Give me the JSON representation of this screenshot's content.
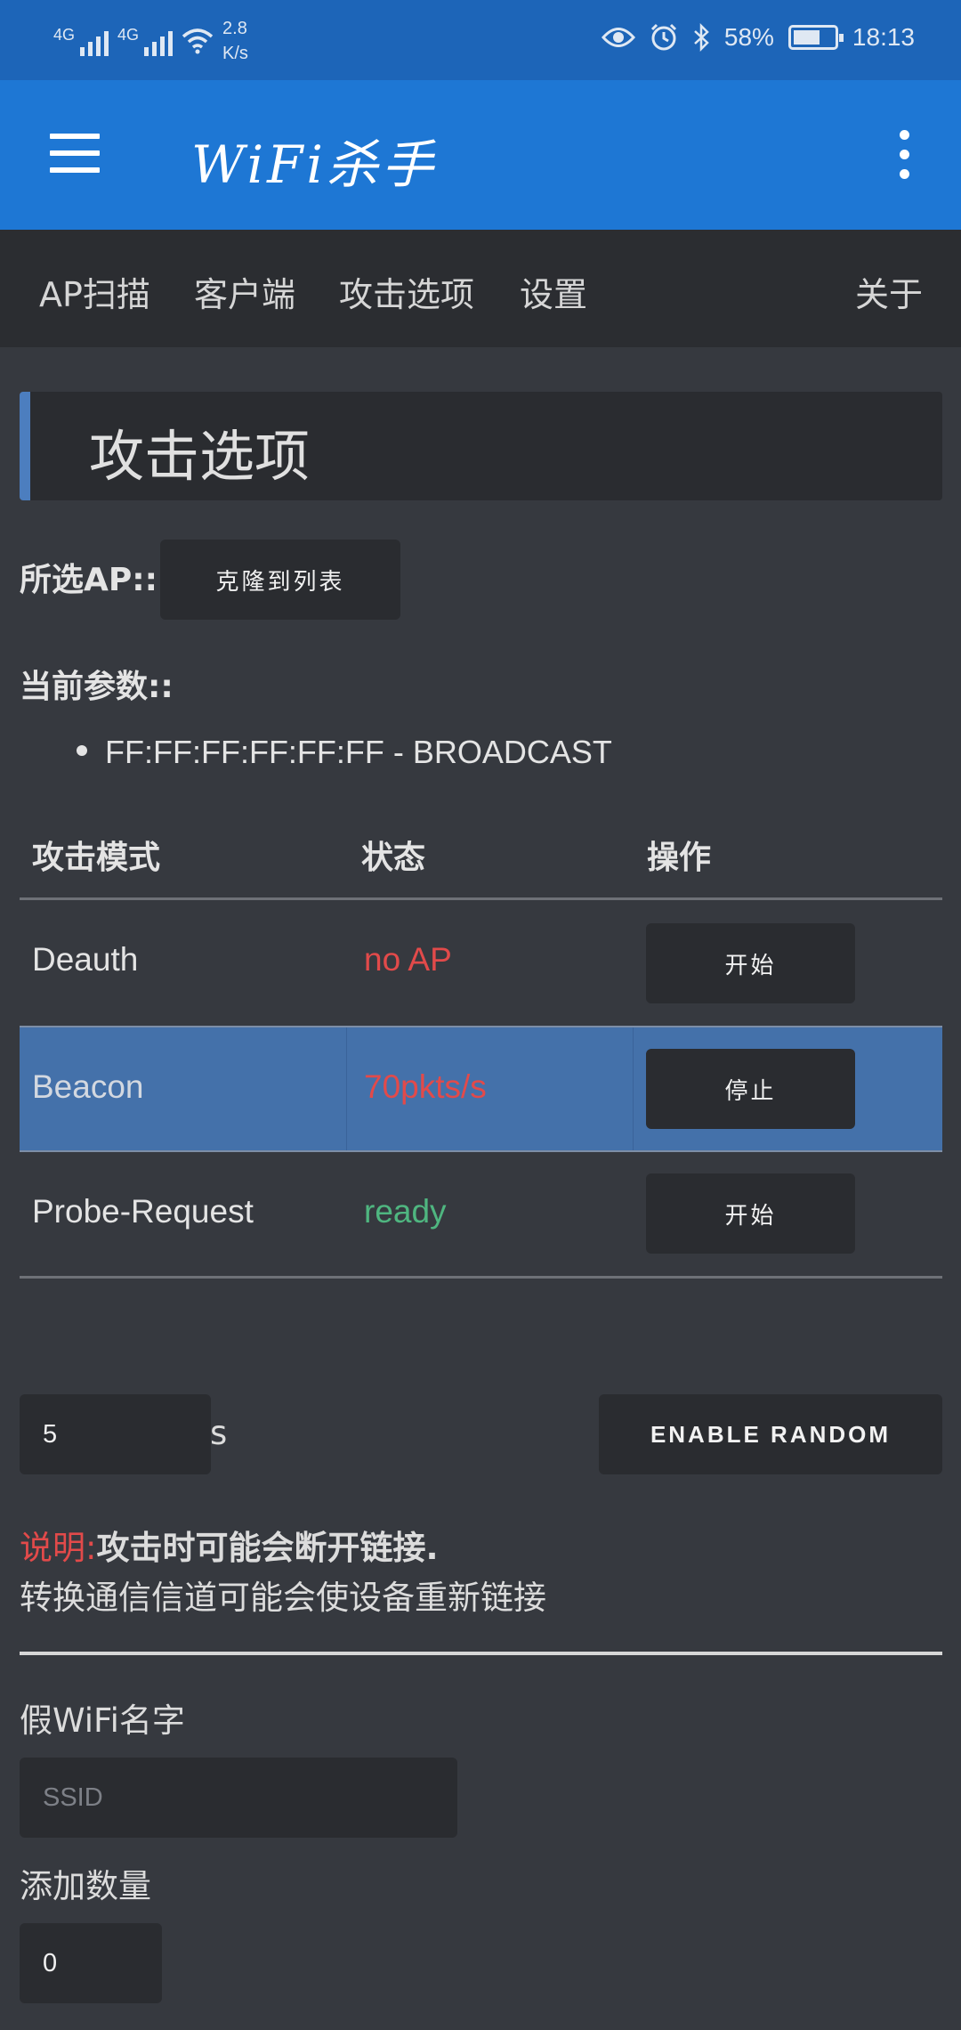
{
  "status_bar": {
    "signal1": "4G",
    "signal2": "4G",
    "net_speed_value": "2.8",
    "net_speed_unit": "K/s",
    "battery_percent": "58%",
    "battery_level": 0.58,
    "time": "18:13",
    "icons": [
      "eye-comfort-icon",
      "alarm-icon",
      "bluetooth-icon",
      "battery-icon"
    ]
  },
  "app_bar": {
    "title": "WiFi杀手",
    "menu_icon": "hamburger-icon",
    "overflow_icon": "kebab-menu-icon"
  },
  "tabs": [
    "AP扫描",
    "客户端",
    "攻击选项",
    "设置",
    "关于"
  ],
  "section_title": "攻击选项",
  "selected_ap": {
    "label": "所选AP::",
    "clone_button": "克隆到列表"
  },
  "current_params": {
    "label": "当前参数::",
    "items": [
      "FF:FF:FF:FF:FF:FF - BROADCAST"
    ]
  },
  "attack_table": {
    "headers": [
      "攻击模式",
      "状态",
      "操作"
    ],
    "rows": [
      {
        "mode": "Deauth",
        "status": "no AP",
        "status_color": "#e24a4a",
        "action": "开始",
        "selected": false
      },
      {
        "mode": "Beacon",
        "status": "70pkts/s",
        "status_color": "#e24a4a",
        "action": "停止",
        "selected": true
      },
      {
        "mode": "Probe-Request",
        "status": "ready",
        "status_color": "#4fb680",
        "action": "开始",
        "selected": false
      }
    ]
  },
  "interval": {
    "value": "5",
    "unit": "s",
    "random_button": "ENABLE RANDOM"
  },
  "note": {
    "prefix": "说明:",
    "bold": "攻击时可能会断开链接.",
    "line2": "转换通信信道可能会使设备重新链接"
  },
  "fake_wifi": {
    "label": "假WiFi名字",
    "ssid_placeholder": "SSID",
    "count_label": "添加数量",
    "count_value": "0"
  },
  "colors": {
    "status_bar": "#1d65b8",
    "app_bar": "#1e77d4",
    "tabs_bg": "#2b2d31",
    "page_bg": "#36393f",
    "accent": "#4c7ebf",
    "selected_row": "#4471aa"
  }
}
